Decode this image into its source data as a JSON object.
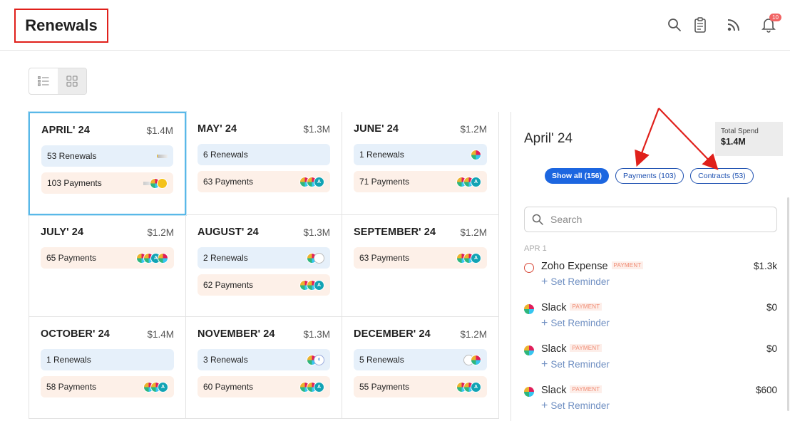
{
  "header": {
    "title": "Renewals",
    "notification_count": "10",
    "icons": [
      "search-icon",
      "clipboard-icon",
      "rss-icon",
      "bell-icon"
    ]
  },
  "view_toggle": {
    "options": [
      "list-view",
      "grid-view"
    ],
    "selected": "grid-view"
  },
  "months": [
    {
      "name": "APRIL' 24",
      "spend": "$1.4M",
      "renewals": "53 Renewals",
      "payments": "103 Payments"
    },
    {
      "name": "MAY' 24",
      "spend": "$1.3M",
      "renewals": "6 Renewals",
      "payments": "63 Payments"
    },
    {
      "name": "JUNE' 24",
      "spend": "$1.2M",
      "renewals": "1 Renewals",
      "payments": "71 Payments"
    },
    {
      "name": "JULY' 24",
      "spend": "$1.2M",
      "renewals": "",
      "payments": "65 Payments"
    },
    {
      "name": "AUGUST' 24",
      "spend": "$1.3M",
      "renewals": "2 Renewals",
      "payments": "62 Payments"
    },
    {
      "name": "SEPTEMBER' 24",
      "spend": "$1.2M",
      "renewals": "",
      "payments": "63 Payments"
    },
    {
      "name": "OCTOBER' 24",
      "spend": "$1.4M",
      "renewals": "1 Renewals",
      "payments": "58 Payments"
    },
    {
      "name": "NOVEMBER' 24",
      "spend": "$1.3M",
      "renewals": "3 Renewals",
      "payments": "60 Payments"
    },
    {
      "name": "DECEMBER' 24",
      "spend": "$1.2M",
      "renewals": "5 Renewals",
      "payments": "55 Payments"
    }
  ],
  "side_panel": {
    "title": "April' 24",
    "total_spend_label": "Total Spend",
    "total_spend_value": "$1.4M",
    "filters": {
      "show_all": "Show all (156)",
      "payments": "Payments (103)",
      "contracts": "Contracts (53)"
    },
    "search_placeholder": "Search",
    "date_group": "APR 1",
    "badge_text": "PAYMENT",
    "reminder_label": "Set Reminder",
    "entries": [
      {
        "name": "Zoho Expense",
        "amount": "$1.3k"
      },
      {
        "name": "Slack",
        "amount": "$0"
      },
      {
        "name": "Slack",
        "amount": "$0"
      },
      {
        "name": "Slack",
        "amount": "$600"
      }
    ]
  },
  "colors": {
    "accent_blue": "#1c66e0",
    "renewal_pill_bg": "#e6f0fa",
    "payment_pill_bg": "#fdf0e8",
    "annotation_red": "#e0201b"
  }
}
